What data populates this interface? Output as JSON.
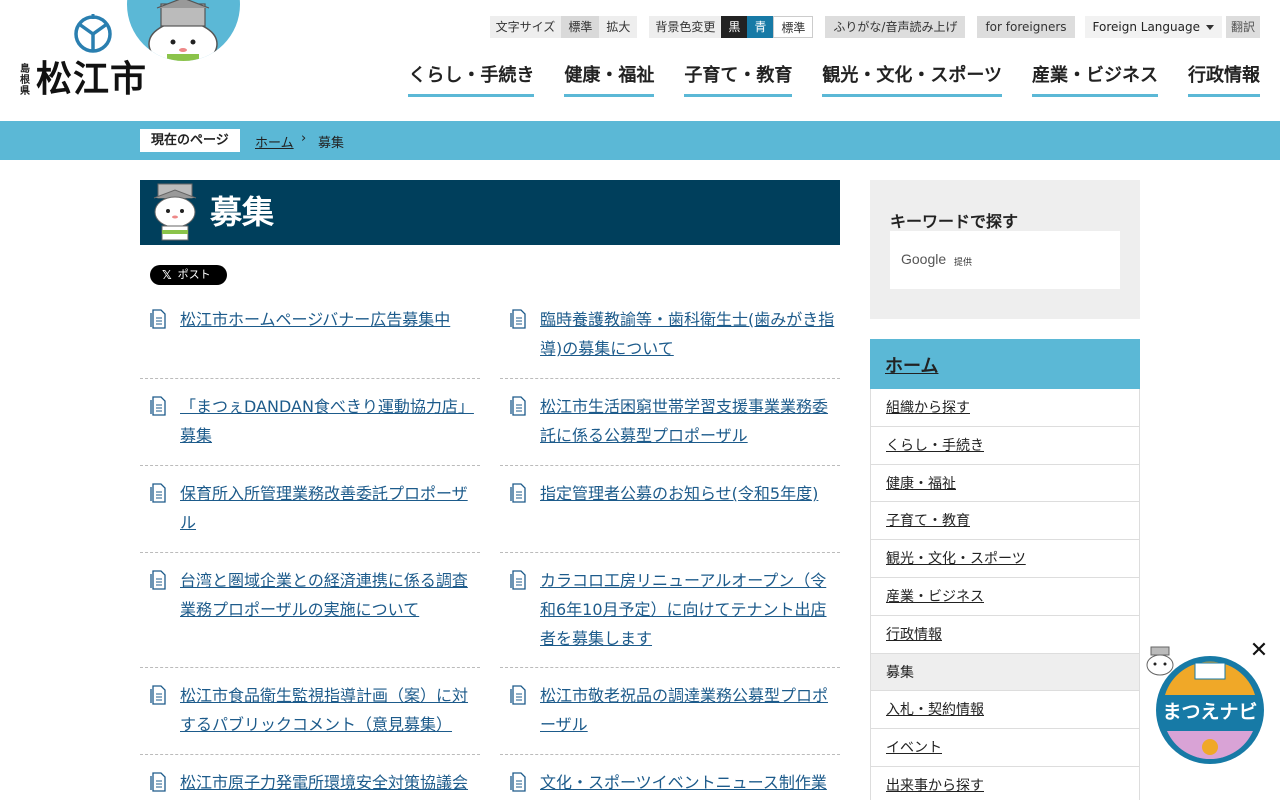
{
  "logo": {
    "prefecture": "島根県",
    "city": "松江市"
  },
  "utility": {
    "font_size_label": "文字サイズ",
    "font_standard": "標準",
    "font_large": "拡大",
    "bg_label": "背景色変更",
    "bg_black": "黒",
    "bg_blue": "青",
    "bg_standard": "標準",
    "furigana": "ふりがな/音声読み上げ",
    "foreigners": "for foreigners",
    "language": "Foreign Language",
    "translate": "翻訳"
  },
  "gnav": [
    "くらし・手続き",
    "健康・福祉",
    "子育て・教育",
    "観光・文化・スポーツ",
    "産業・ビジネス",
    "行政情報"
  ],
  "breadcrumb": {
    "label": "現在のページ",
    "home": "ホーム",
    "separator": "›",
    "current": "募集"
  },
  "page_title": "募集",
  "share": {
    "x_label": "ポスト"
  },
  "items": [
    "松江市ホームページバナー広告募集中",
    "臨時養護教諭等・歯科衛生士(歯みがき指導)の募集について",
    "「まつぇDANDAN食べきり運動協力店」募集",
    "松江市生活困窮世帯学習支援事業業務委託に係る公募型プロポーザル",
    "保育所入所管理業務改善委託プロポーザル",
    "指定管理者公募のお知らせ(令和5年度)",
    "台湾と圏域企業との経済連携に係る調査業務プロポーザルの実施について",
    "カラコロ工房リニューアルオープン（令和6年10月予定）に向けてテナント出店者を募集します",
    "松江市食品衛生監視指導計画（案）に対するパブリックコメント（意見募集）",
    "松江市敬老祝品の調達業務公募型プロポーザル",
    "松江市原子力発電所環境安全対策協議会",
    "文化・スポーツイベントニュース制作業"
  ],
  "sidebar": {
    "search_title": "キーワードで探す",
    "google": "Google",
    "google_sub": "提供",
    "nav_head": "ホーム",
    "nav_items": [
      "組織から探す",
      "くらし・手続き",
      "健康・福祉",
      "子育て・教育",
      "観光・文化・スポーツ",
      "産業・ビジネス",
      "行政情報",
      "募集",
      "入札・契約情報",
      "イベント",
      "出来事から探す"
    ],
    "current_index": 7
  },
  "widget": {
    "label": "まつえナビ",
    "close": "✕"
  },
  "colors": {
    "accent": "#5bb8d6",
    "title_bg": "#003f5c",
    "link": "#1d5b8b"
  }
}
